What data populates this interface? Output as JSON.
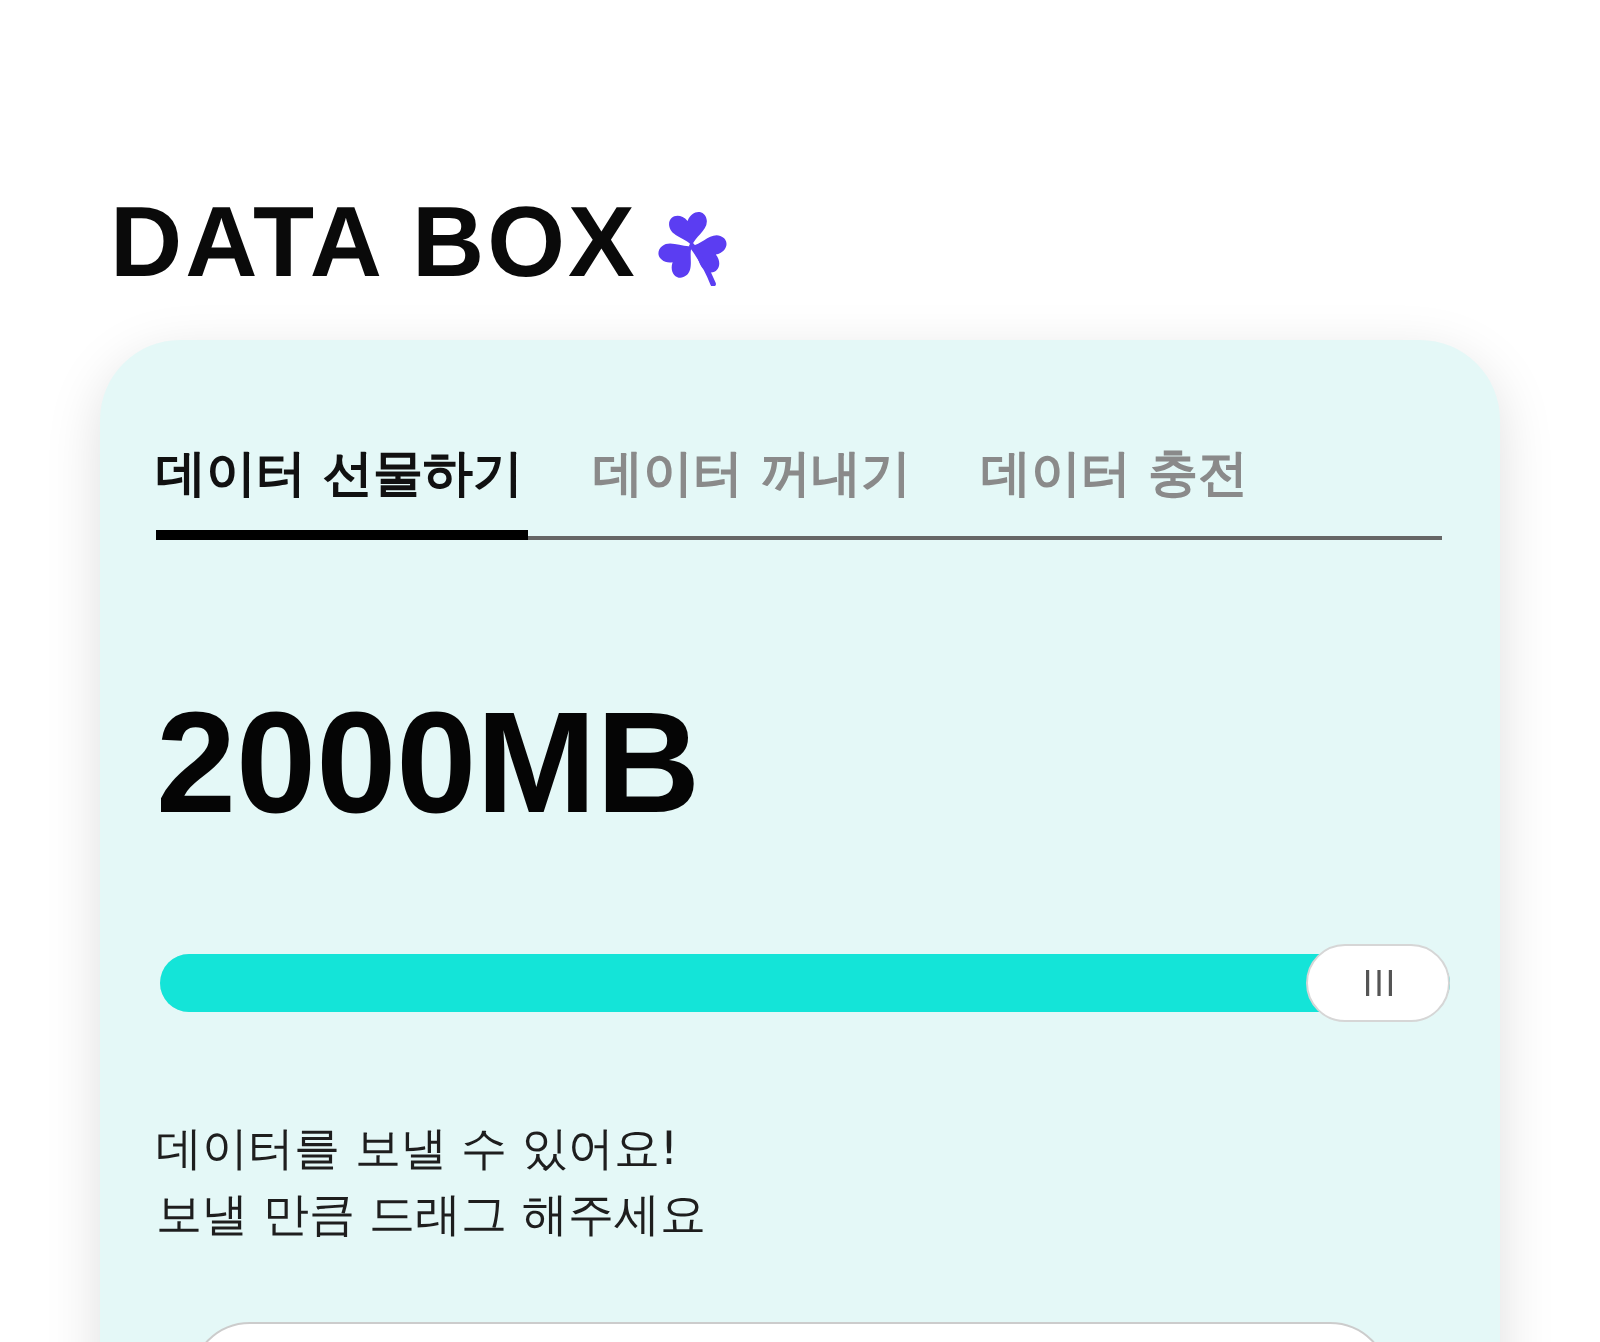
{
  "logo": {
    "text": "DATA BOX"
  },
  "tabs": [
    {
      "label": "데이터 선물하기",
      "selected": true
    },
    {
      "label": "데이터 꺼내기",
      "selected": false
    },
    {
      "label": "데이터 충전",
      "selected": false
    }
  ],
  "amount": "2000MB",
  "slider": {
    "level": 1
  },
  "message": [
    "데이터를 보낼 수 있어요!",
    "보낼 만큼 드래그 해주세요"
  ]
}
